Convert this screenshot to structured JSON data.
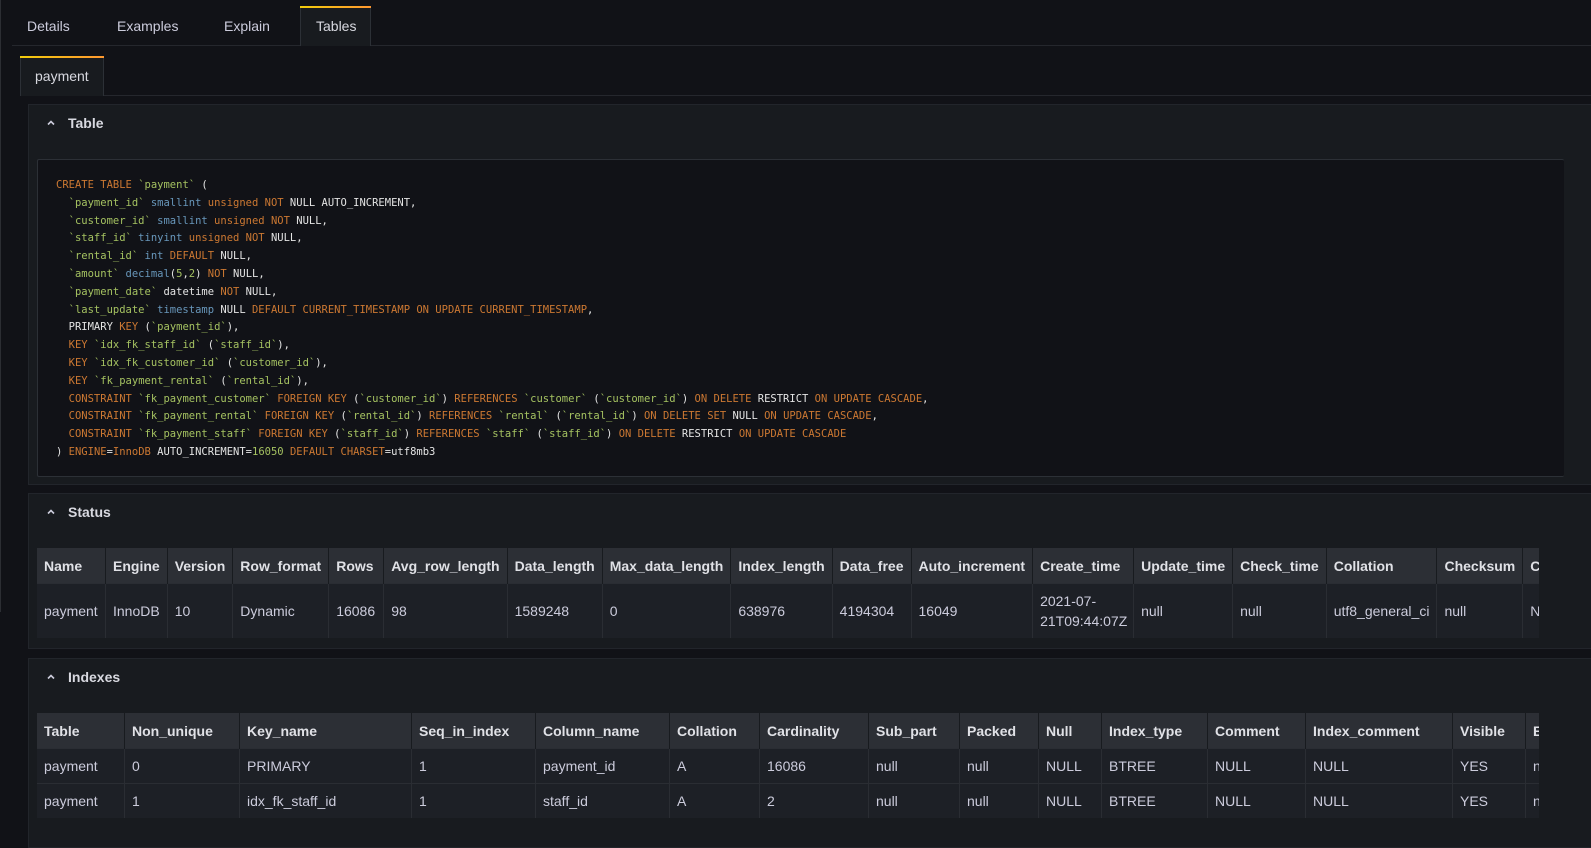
{
  "tabs": [
    "Details",
    "Examples",
    "Explain",
    "Tables"
  ],
  "subtab": "payment",
  "sections": {
    "table": "Table",
    "status": "Status",
    "indexes": "Indexes"
  },
  "code_lines": [
    [
      [
        "kw",
        "CREATE TABLE "
      ],
      [
        "st",
        "`payment`"
      ],
      [
        "plain",
        " ("
      ]
    ],
    [
      [
        "st",
        "  `payment_id`"
      ],
      [
        "ty",
        " smallint"
      ],
      [
        "kw",
        " unsigned NOT"
      ],
      [
        "plain",
        " NULL AUTO_INCREMENT,"
      ]
    ],
    [
      [
        "st",
        "  `customer_id`"
      ],
      [
        "ty",
        " smallint"
      ],
      [
        "kw",
        " unsigned NOT"
      ],
      [
        "plain",
        " NULL,"
      ]
    ],
    [
      [
        "st",
        "  `staff_id`"
      ],
      [
        "ty",
        " tinyint"
      ],
      [
        "kw",
        " unsigned NOT"
      ],
      [
        "plain",
        " NULL,"
      ]
    ],
    [
      [
        "st",
        "  `rental_id`"
      ],
      [
        "ty",
        " int"
      ],
      [
        "kw",
        " DEFAULT"
      ],
      [
        "plain",
        " NULL,"
      ]
    ],
    [
      [
        "st",
        "  `amount`"
      ],
      [
        "ty",
        " decimal"
      ],
      [
        "plain",
        "("
      ],
      [
        "st",
        "5"
      ],
      [
        "plain",
        ","
      ],
      [
        "st",
        "2"
      ],
      [
        "plain",
        ")"
      ],
      [
        "kw",
        " NOT"
      ],
      [
        "plain",
        " NULL,"
      ]
    ],
    [
      [
        "st",
        "  `payment_date`"
      ],
      [
        "plain",
        " datetime"
      ],
      [
        "kw",
        " NOT"
      ],
      [
        "plain",
        " NULL,"
      ]
    ],
    [
      [
        "st",
        "  `last_update`"
      ],
      [
        "ty",
        " timestamp"
      ],
      [
        "plain",
        " NULL"
      ],
      [
        "kw",
        " DEFAULT CURRENT_TIMESTAMP ON UPDATE CURRENT_TIMESTAMP"
      ],
      [
        "plain",
        ","
      ]
    ],
    [
      [
        "plain",
        "  PRIMARY"
      ],
      [
        "kw",
        " KEY"
      ],
      [
        "plain",
        " ("
      ],
      [
        "st",
        "`payment_id`"
      ],
      [
        "plain",
        "),"
      ]
    ],
    [
      [
        "kw",
        "  KEY "
      ],
      [
        "st",
        "`idx_fk_staff_id`"
      ],
      [
        "plain",
        " ("
      ],
      [
        "st",
        "`staff_id`"
      ],
      [
        "plain",
        "),"
      ]
    ],
    [
      [
        "kw",
        "  KEY "
      ],
      [
        "st",
        "`idx_fk_customer_id`"
      ],
      [
        "plain",
        " ("
      ],
      [
        "st",
        "`customer_id`"
      ],
      [
        "plain",
        "),"
      ]
    ],
    [
      [
        "kw",
        "  KEY "
      ],
      [
        "st",
        "`fk_payment_rental`"
      ],
      [
        "plain",
        " ("
      ],
      [
        "st",
        "`rental_id`"
      ],
      [
        "plain",
        "),"
      ]
    ],
    [
      [
        "kw",
        "  CONSTRAINT "
      ],
      [
        "st",
        "`fk_payment_customer`"
      ],
      [
        "kw",
        " FOREIGN KEY"
      ],
      [
        "plain",
        " ("
      ],
      [
        "st",
        "`customer_id`"
      ],
      [
        "plain",
        ")"
      ],
      [
        "kw",
        " REFERENCES "
      ],
      [
        "st",
        "`customer`"
      ],
      [
        "plain",
        " ("
      ],
      [
        "st",
        "`customer_id`"
      ],
      [
        "plain",
        ")"
      ],
      [
        "kw",
        " ON DELETE"
      ],
      [
        "plain",
        " RESTRICT"
      ],
      [
        "kw",
        " ON UPDATE CASCADE"
      ],
      [
        "plain",
        ","
      ]
    ],
    [
      [
        "kw",
        "  CONSTRAINT "
      ],
      [
        "st",
        "`fk_payment_rental`"
      ],
      [
        "kw",
        " FOREIGN KEY"
      ],
      [
        "plain",
        " ("
      ],
      [
        "st",
        "`rental_id`"
      ],
      [
        "plain",
        ")"
      ],
      [
        "kw",
        " REFERENCES "
      ],
      [
        "st",
        "`rental`"
      ],
      [
        "plain",
        " ("
      ],
      [
        "st",
        "`rental_id`"
      ],
      [
        "plain",
        ")"
      ],
      [
        "kw",
        " ON DELETE SET"
      ],
      [
        "plain",
        " NULL"
      ],
      [
        "kw",
        " ON UPDATE CASCADE"
      ],
      [
        "plain",
        ","
      ]
    ],
    [
      [
        "kw",
        "  CONSTRAINT "
      ],
      [
        "st",
        "`fk_payment_staff`"
      ],
      [
        "kw",
        " FOREIGN KEY"
      ],
      [
        "plain",
        " ("
      ],
      [
        "st",
        "`staff_id`"
      ],
      [
        "plain",
        ")"
      ],
      [
        "kw",
        " REFERENCES "
      ],
      [
        "st",
        "`staff`"
      ],
      [
        "plain",
        " ("
      ],
      [
        "st",
        "`staff_id`"
      ],
      [
        "plain",
        ")"
      ],
      [
        "kw",
        " ON DELETE"
      ],
      [
        "plain",
        " RESTRICT"
      ],
      [
        "kw",
        " ON UPDATE CASCADE"
      ]
    ],
    [
      [
        "plain",
        ") "
      ],
      [
        "kw",
        "ENGINE"
      ],
      [
        "plain",
        "="
      ],
      [
        "kw",
        "InnoDB"
      ],
      [
        "plain",
        " AUTO_INCREMENT="
      ],
      [
        "st",
        "16050"
      ],
      [
        "kw",
        " DEFAULT CHARSET"
      ],
      [
        "plain",
        "=utf8mb3"
      ]
    ]
  ],
  "status": {
    "columns": [
      "Name",
      "Engine",
      "Version",
      "Row_format",
      "Rows",
      "Avg_row_length",
      "Data_length",
      "Max_data_length",
      "Index_length",
      "Data_free",
      "Auto_increment",
      "Create_time",
      "Update_time",
      "Check_time",
      "Collation",
      "Checksum",
      "Create_options"
    ],
    "rows": [
      [
        "payment",
        "InnoDB",
        "10",
        "Dynamic",
        "16086",
        "98",
        "1589248",
        "0",
        "638976",
        "4194304",
        "16049",
        "2021-07-21T09:44:07Z",
        "null",
        "null",
        "utf8_general_ci",
        "null",
        "NULL"
      ]
    ]
  },
  "indexes": {
    "columns": [
      "Table",
      "Non_unique",
      "Key_name",
      "Seq_in_index",
      "Column_name",
      "Collation",
      "Cardinality",
      "Sub_part",
      "Packed",
      "Null",
      "Index_type",
      "Comment",
      "Index_comment",
      "Visible",
      "Expression"
    ],
    "rows": [
      [
        "payment",
        "0",
        "PRIMARY",
        "1",
        "payment_id",
        "A",
        "16086",
        "null",
        "null",
        "NULL",
        "BTREE",
        "NULL",
        "NULL",
        "YES",
        "null"
      ],
      [
        "payment",
        "1",
        "idx_fk_staff_id",
        "1",
        "staff_id",
        "A",
        "2",
        "null",
        "null",
        "NULL",
        "BTREE",
        "NULL",
        "NULL",
        "YES",
        "null"
      ]
    ]
  }
}
